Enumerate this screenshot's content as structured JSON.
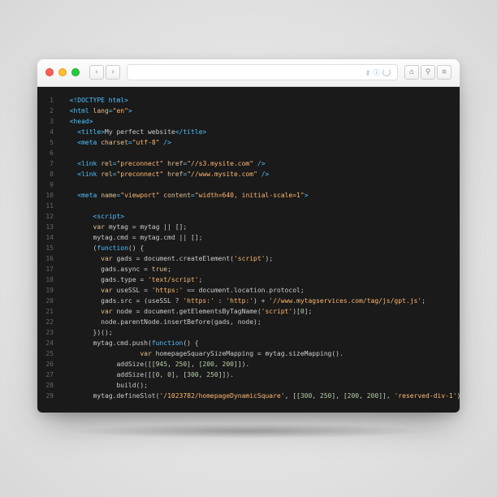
{
  "urlbar": {
    "secure_label": "⚷ ⓘ"
  },
  "code": {
    "lines": [
      [
        0,
        [
          [
            "t",
            "<!DOCTYPE html>"
          ]
        ]
      ],
      [
        0,
        [
          [
            "t",
            "<html "
          ],
          [
            "a",
            "lang"
          ],
          [
            "t",
            "="
          ],
          [
            "s",
            "\"en\""
          ],
          [
            "t",
            ">"
          ]
        ]
      ],
      [
        0,
        [
          [
            "t",
            "<head>"
          ]
        ]
      ],
      [
        1,
        [
          [
            "t",
            "<title>"
          ],
          [
            "p",
            "My perfect website"
          ],
          [
            "t",
            "</title>"
          ]
        ]
      ],
      [
        1,
        [
          [
            "t",
            "<meta "
          ],
          [
            "a",
            "charset"
          ],
          [
            "t",
            "="
          ],
          [
            "s",
            "\"utf-8\""
          ],
          [
            "t",
            " />"
          ]
        ]
      ],
      [
        0,
        []
      ],
      [
        1,
        [
          [
            "t",
            "<link "
          ],
          [
            "a",
            "rel"
          ],
          [
            "t",
            "="
          ],
          [
            "s",
            "\"preconnect\""
          ],
          [
            "t",
            " "
          ],
          [
            "a",
            "href"
          ],
          [
            "t",
            "="
          ],
          [
            "s",
            "\"//s3.mysite.com\""
          ],
          [
            "t",
            " />"
          ]
        ]
      ],
      [
        1,
        [
          [
            "t",
            "<link "
          ],
          [
            "a",
            "rel"
          ],
          [
            "t",
            "="
          ],
          [
            "s",
            "\"preconnect\""
          ],
          [
            "t",
            " "
          ],
          [
            "a",
            "href"
          ],
          [
            "t",
            "="
          ],
          [
            "s",
            "\"//www.mysite.com\""
          ],
          [
            "t",
            " />"
          ]
        ]
      ],
      [
        0,
        []
      ],
      [
        1,
        [
          [
            "t",
            "<meta "
          ],
          [
            "a",
            "name"
          ],
          [
            "t",
            "="
          ],
          [
            "s",
            "\"viewport\""
          ],
          [
            "t",
            " "
          ],
          [
            "a",
            "content"
          ],
          [
            "t",
            "="
          ],
          [
            "s",
            "\"width=640, initial-scale=1\""
          ],
          [
            "t",
            ">"
          ]
        ]
      ],
      [
        0,
        []
      ],
      [
        3,
        [
          [
            "t",
            "<script>"
          ]
        ]
      ],
      [
        3,
        [
          [
            "k",
            "var"
          ],
          [
            "p",
            " mytag = mytag || [];"
          ]
        ]
      ],
      [
        3,
        [
          [
            "p",
            "mytag.cmd = mytag.cmd || [];"
          ]
        ]
      ],
      [
        3,
        [
          [
            "p",
            "("
          ],
          [
            "fn",
            "function"
          ],
          [
            "p",
            "() {"
          ]
        ]
      ],
      [
        4,
        [
          [
            "k",
            "var"
          ],
          [
            "p",
            " gads = document.createElement("
          ],
          [
            "s",
            "'script'"
          ],
          [
            "p",
            ");"
          ]
        ]
      ],
      [
        4,
        [
          [
            "p",
            "gads.async = "
          ],
          [
            "kw",
            "true"
          ],
          [
            "p",
            ";"
          ]
        ]
      ],
      [
        4,
        [
          [
            "p",
            "gads.type = "
          ],
          [
            "s",
            "'text/script'"
          ],
          [
            "p",
            ";"
          ]
        ]
      ],
      [
        4,
        [
          [
            "k",
            "var"
          ],
          [
            "p",
            " useSSL = "
          ],
          [
            "s",
            "'https:'"
          ],
          [
            "p",
            " == document.location.protocol;"
          ]
        ]
      ],
      [
        4,
        [
          [
            "p",
            "gads.src = (useSSL ? "
          ],
          [
            "s",
            "'https:'"
          ],
          [
            "p",
            " : "
          ],
          [
            "s",
            "'http:'"
          ],
          [
            "p",
            ") + "
          ],
          [
            "s",
            "'//www.mytagservices.com/tag/js/gpt.js'"
          ],
          [
            "p",
            ";"
          ]
        ]
      ],
      [
        4,
        [
          [
            "k",
            "var"
          ],
          [
            "p",
            " node = document.getElementsByTagName("
          ],
          [
            "s",
            "'script'"
          ],
          [
            "p",
            ")["
          ],
          [
            "n",
            "0"
          ],
          [
            "p",
            "];"
          ]
        ]
      ],
      [
        4,
        [
          [
            "p",
            "node.parentNode.insertBefore(gads, node);"
          ]
        ]
      ],
      [
        3,
        [
          [
            "p",
            "})();"
          ]
        ]
      ],
      [
        3,
        [
          [
            "p",
            "mytag.cmd.push("
          ],
          [
            "fn",
            "function"
          ],
          [
            "p",
            "() {"
          ]
        ]
      ],
      [
        9,
        [
          [
            "k",
            "var"
          ],
          [
            "p",
            " homepageSquarySizeMapping = mytag.sizeMapping()."
          ]
        ]
      ],
      [
        6,
        [
          [
            "p",
            "addSize([["
          ],
          [
            "n",
            "945"
          ],
          [
            "p",
            ", "
          ],
          [
            "n",
            "250"
          ],
          [
            "p",
            "], ["
          ],
          [
            "n",
            "200"
          ],
          [
            "p",
            ", "
          ],
          [
            "n",
            "200"
          ],
          [
            "p",
            "]])."
          ]
        ]
      ],
      [
        6,
        [
          [
            "p",
            "addSize([["
          ],
          [
            "n",
            "0"
          ],
          [
            "p",
            ", "
          ],
          [
            "n",
            "0"
          ],
          [
            "p",
            "], ["
          ],
          [
            "n",
            "300"
          ],
          [
            "p",
            ", "
          ],
          [
            "n",
            "250"
          ],
          [
            "p",
            "]])."
          ]
        ]
      ],
      [
        6,
        [
          [
            "p",
            "build();"
          ]
        ]
      ],
      [
        3,
        [
          [
            "p",
            "mytag.defineSlot("
          ],
          [
            "s",
            "'/1023782/homepageDynamicSquare'"
          ],
          [
            "p",
            ", [["
          ],
          [
            "n",
            "300"
          ],
          [
            "p",
            ", "
          ],
          [
            "n",
            "250"
          ],
          [
            "p",
            "], ["
          ],
          [
            "n",
            "200"
          ],
          [
            "p",
            ", "
          ],
          [
            "n",
            "200"
          ],
          [
            "p",
            "]], "
          ],
          [
            "s",
            "'reserved-div-1'"
          ],
          [
            "p",
            ")."
          ]
        ]
      ]
    ]
  }
}
